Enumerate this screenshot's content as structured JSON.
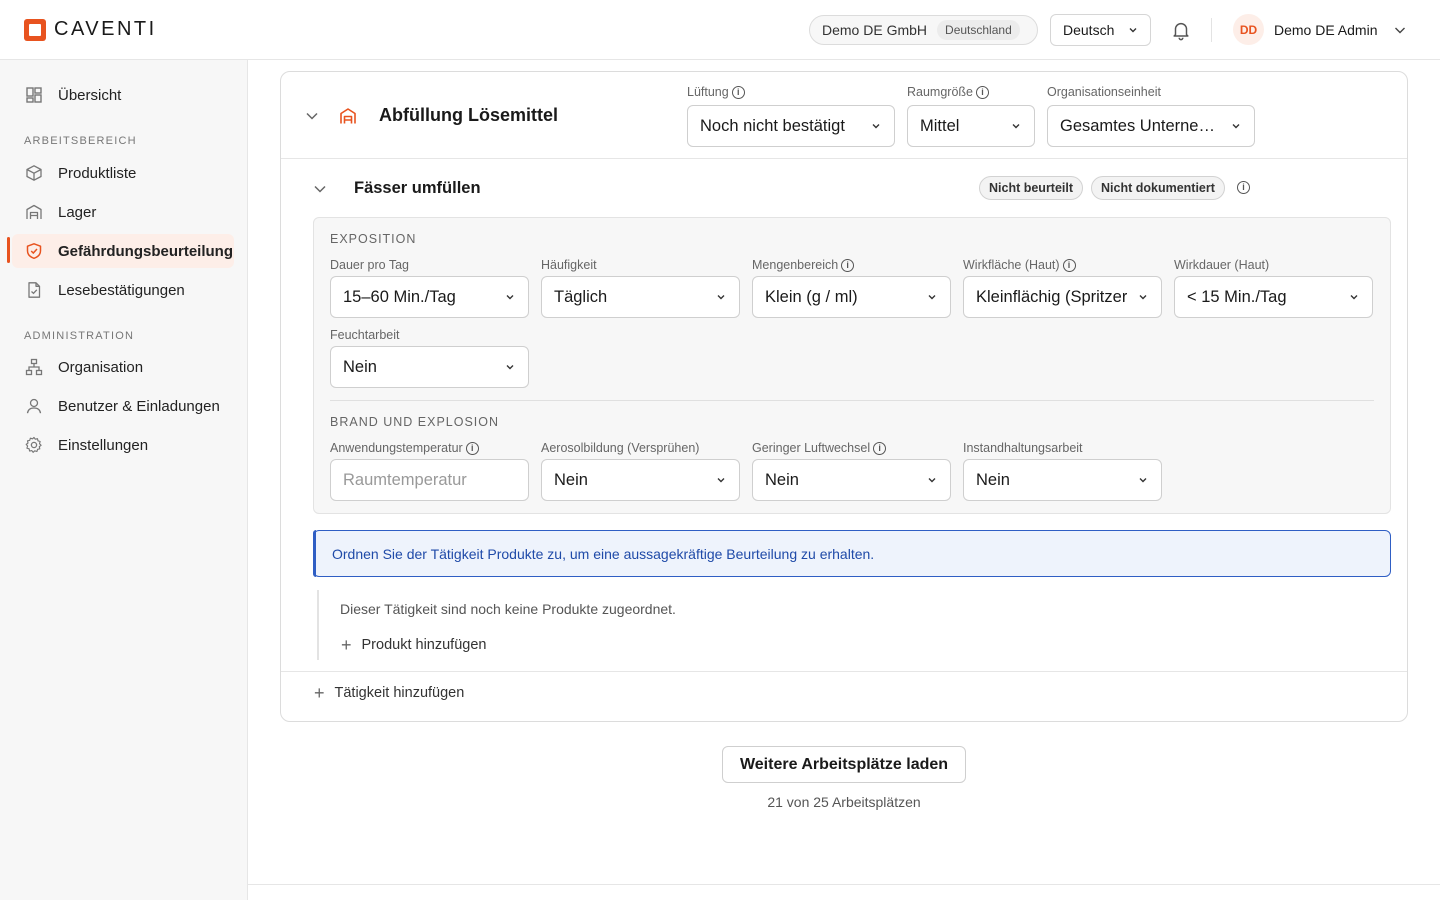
{
  "header": {
    "logo_text": "CAVENTI",
    "org_name": "Demo DE GmbH",
    "org_country": "Deutschland",
    "language": "Deutsch",
    "user_initials": "DD",
    "user_name": "Demo DE Admin"
  },
  "sidebar": {
    "overview": "Übersicht",
    "section_workspace": "ARBEITSBEREICH",
    "product_list": "Produktliste",
    "storage": "Lager",
    "risk_assessment": "Gefährdungsbeurteilung",
    "read_confirmations": "Lesebestätigungen",
    "section_admin": "ADMINISTRATION",
    "organisation": "Organisation",
    "users": "Benutzer & Einladungen",
    "settings": "Einstellungen",
    "active_item": "Gefährdungsbeurteilung"
  },
  "workplace": {
    "title": "Abfüllung Lösemittel",
    "ventilation_label": "Lüftung",
    "ventilation_value": "Noch nicht bestätigt",
    "room_size_label": "Raumgröße",
    "room_size_value": "Mittel",
    "org_unit_label": "Organisationseinheit",
    "org_unit_value": "Gesamtes Unternehmen"
  },
  "activity": {
    "title": "Fässer umfüllen",
    "badge_assessed": "Nicht beurteilt",
    "badge_documented": "Nicht dokumentiert",
    "exposure": {
      "section_title": "EXPOSITION",
      "duration_label": "Dauer pro Tag",
      "duration_value": "15–60 Min./Tag",
      "frequency_label": "Häufigkeit",
      "frequency_value": "Täglich",
      "quantity_label": "Mengenbereich",
      "quantity_value": "Klein (g / ml)",
      "skin_area_label": "Wirkfläche (Haut)",
      "skin_area_value": "Kleinflächig (Spritzer)",
      "skin_duration_label": "Wirkdauer (Haut)",
      "skin_duration_value": "< 15 Min./Tag",
      "wet_work_label": "Feuchtarbeit",
      "wet_work_value": "Nein"
    },
    "fire": {
      "section_title": "BRAND UND EXPLOSION",
      "temp_label": "Anwendungstemperatur",
      "temp_placeholder": "Raumtemperatur",
      "aerosol_label": "Aerosolbildung (Versprühen)",
      "aerosol_value": "Nein",
      "air_exchange_label": "Geringer Luftwechsel",
      "air_exchange_value": "Nein",
      "maintenance_label": "Instandhaltungsarbeit",
      "maintenance_value": "Nein"
    },
    "notice": "Ordnen Sie der Tätigkeit Produkte zu, um eine aussagekräftige Beurteilung zu erhalten.",
    "no_products": "Dieser Tätigkeit sind noch keine Produkte zugeordnet.",
    "add_product": "Produkt hinzufügen"
  },
  "add_activity": "Tätigkeit hinzufügen",
  "load_more": "Weitere Arbeitsplätze laden",
  "count_text": "21 von 25 Arbeitsplätzen",
  "colors": {
    "accent": "#e8531f",
    "info_blue": "#2f5ec4"
  }
}
